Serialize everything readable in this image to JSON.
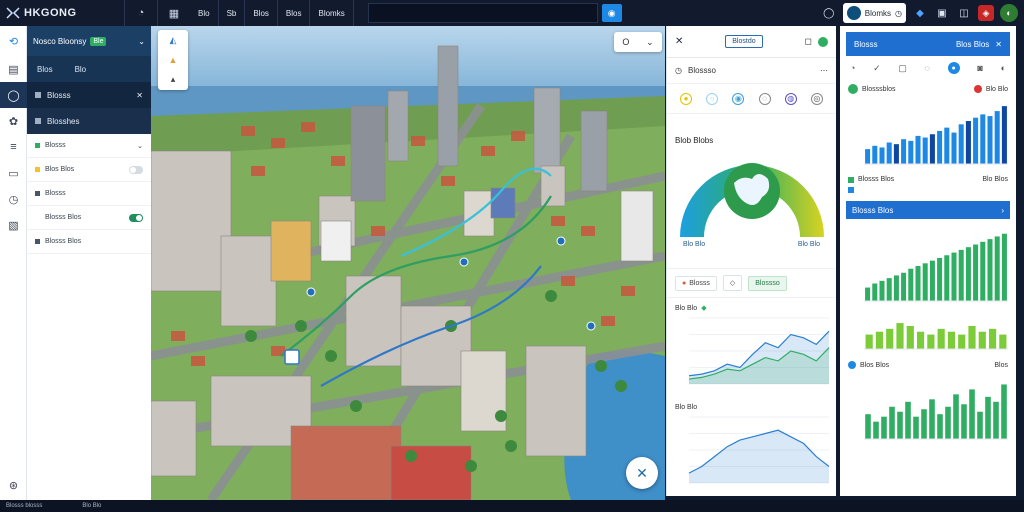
{
  "app": {
    "title": "HKGONG"
  },
  "topbar": {
    "menu": [
      "Blo",
      "Sb",
      "Blos",
      "Blos",
      "Blomks"
    ],
    "user_name": "Blomks"
  },
  "left_panel": {
    "header_title": "Nosco Bloonsy",
    "header_badge": "Ble",
    "sub_tabs": [
      "Blos",
      "Blo"
    ],
    "section_a": "Blosss",
    "section_b": "Blosshes",
    "items": [
      {
        "label": "Blosss",
        "value": ""
      },
      {
        "label": "Blos Blos",
        "value": ""
      },
      {
        "label": "Blosss",
        "value": ""
      },
      {
        "label": "Blosss Blos",
        "value": ""
      },
      {
        "label": "Blosss Blos",
        "value": ""
      }
    ]
  },
  "map": {
    "select_value": "O"
  },
  "middle_panel": {
    "header_button": "Blostdo",
    "row_title": "Blossso",
    "gauge_title": "Blob Blobs",
    "gauge_left": "Blo Blo",
    "gauge_right": "Blo Blo",
    "tab_a": "Blosss",
    "tab_b": "Blossso",
    "chart1_title": "Blo Blo",
    "chart2_title": "Blo Blo"
  },
  "right_panel": {
    "header_title": "Blosss",
    "header_value": "Blos Blos",
    "stat_label": "Blosssblos",
    "stat_value": "Blo Blo",
    "legend_a": "Blosss Blos",
    "legend_b": "Blo Blos",
    "header2_title": "Blosss Blos",
    "chart_c_title": "Blos Blos",
    "chart_c_value": "Blos"
  },
  "statusbar": {
    "left": "Blosss blosss",
    "mid": "Blo Blo"
  },
  "chart_data": [
    {
      "type": "area",
      "x": [
        0,
        1,
        2,
        3,
        4,
        5,
        6,
        7,
        8,
        9,
        10,
        11
      ],
      "series": [
        {
          "values": [
            5,
            6,
            8,
            12,
            10,
            18,
            25,
            22,
            30,
            28,
            24,
            32
          ]
        },
        {
          "values": [
            3,
            4,
            6,
            9,
            8,
            12,
            16,
            14,
            20,
            18,
            14,
            22
          ]
        }
      ],
      "ylim": [
        0,
        40
      ]
    },
    {
      "type": "area",
      "x": [
        0,
        1,
        2,
        3,
        4,
        5,
        6,
        7,
        8,
        9,
        10,
        11
      ],
      "series": [
        {
          "values": [
            6,
            10,
            16,
            22,
            26,
            28,
            30,
            32,
            28,
            24,
            16,
            10
          ]
        }
      ],
      "ylim": [
        0,
        40
      ]
    },
    {
      "type": "bar",
      "values": [
        18,
        22,
        20,
        26,
        24,
        30,
        28,
        34,
        32,
        36,
        40,
        44,
        38,
        48,
        52,
        56,
        60,
        58,
        64,
        70
      ],
      "ylim": [
        0,
        75
      ]
    },
    {
      "type": "bar",
      "values": [
        20,
        26,
        30,
        34,
        38,
        42,
        48,
        52,
        56,
        60,
        64,
        68,
        72,
        76,
        80,
        84,
        88,
        92,
        96,
        100
      ],
      "ylim": [
        0,
        110
      ]
    },
    {
      "type": "bar",
      "values": [
        10,
        12,
        14,
        18,
        16,
        12,
        10,
        14,
        12,
        10,
        16,
        12,
        14,
        10
      ],
      "ylim": [
        0,
        25
      ]
    },
    {
      "type": "bar",
      "values": [
        20,
        14,
        18,
        26,
        22,
        30,
        18,
        24,
        32,
        20,
        26,
        36,
        28,
        40,
        22,
        34,
        30,
        44
      ],
      "ylim": [
        0,
        50
      ]
    }
  ]
}
